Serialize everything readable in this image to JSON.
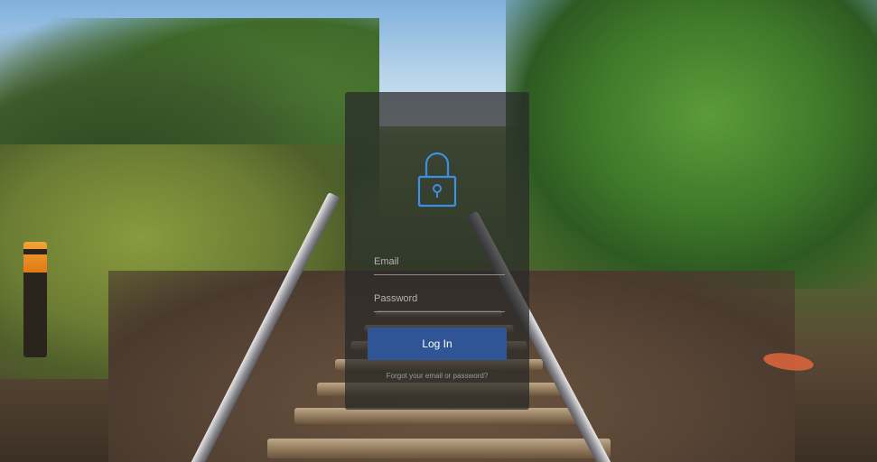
{
  "login": {
    "email_placeholder": "Email",
    "password_placeholder": "Password",
    "login_label": "Log In",
    "forgot_link": "Forgot your email or password?"
  },
  "icons": {
    "lock": "lock-icon"
  },
  "colors": {
    "accent": "#2f5597",
    "icon": "#3b8fe8",
    "panel": "rgba(40,40,40,0.72)"
  }
}
